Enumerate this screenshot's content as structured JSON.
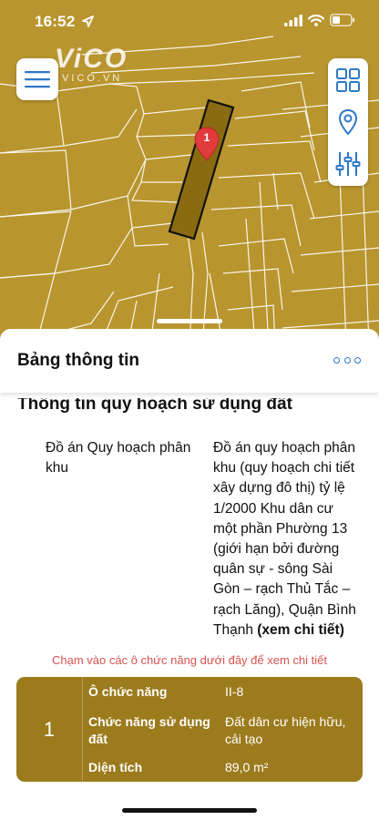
{
  "status_bar": {
    "time": "16:52"
  },
  "watermark": {
    "brand": "ViCO",
    "site": "VICO.VN"
  },
  "map": {
    "marker_label": "1",
    "background_color": "#b8952e",
    "highlight_color": "#8a6b12"
  },
  "sheet": {
    "title": "Bảng thông tin",
    "section_title": "Thông tin quy hoạch sử dụng đất",
    "plan_label": "Đồ án Quy hoạch phân khu",
    "plan_value": "Đồ án quy hoạch phân khu (quy hoạch chi tiết xây dựng đô thị) tỷ lệ 1/2000 Khu dân cư một phần Phường 13 (giới hạn bởi đường quân sự - sông Sài Gòn – rạch Thủ Tắc – rạch Lăng), Quận Bình Thạnh",
    "detail_link": "(xem chi tiết)",
    "hint": "Chạm vào các ô chức năng dưới đây để xem chi tiết"
  },
  "function_card": {
    "index": "1",
    "rows": [
      {
        "label": "Ô chức năng",
        "value": "II-8"
      },
      {
        "label": "Chức năng sử dụng đất",
        "value": "Đất dân cư hiện hữu, cải tạo"
      },
      {
        "label": "Diện tích",
        "value": "89,0 m²"
      }
    ]
  }
}
